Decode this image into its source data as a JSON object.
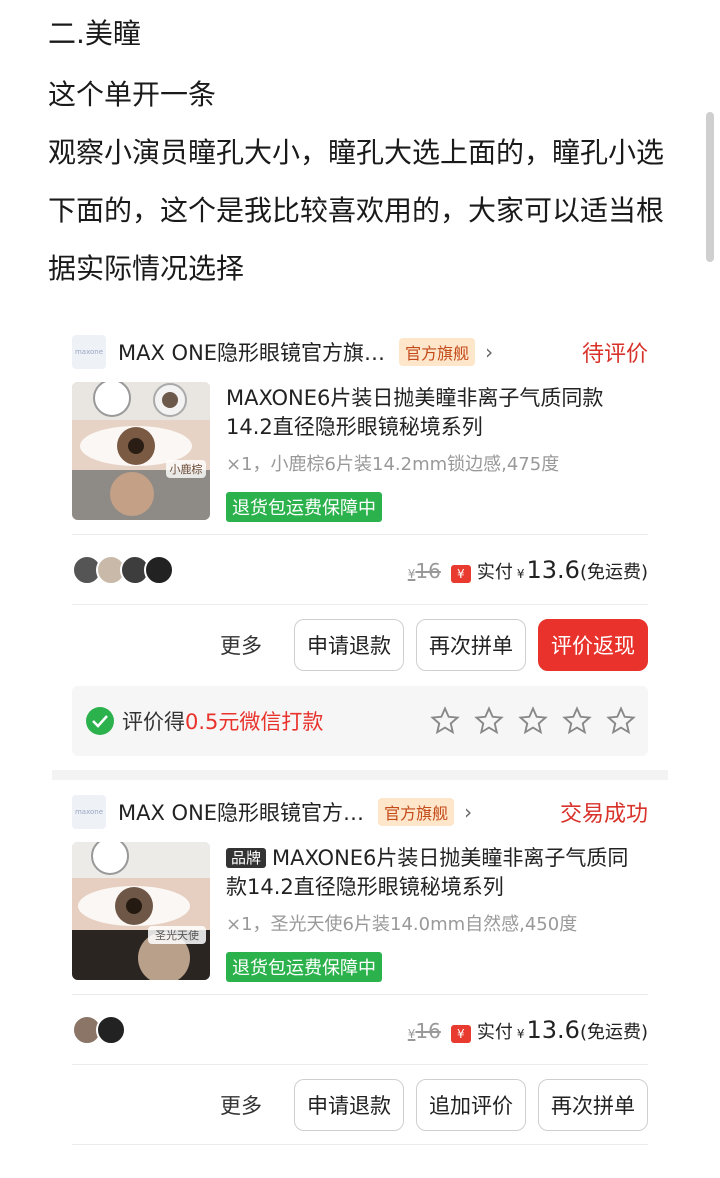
{
  "article": {
    "heading": "二.美瞳",
    "para1": "这个单开一条",
    "para2": "观察小演员瞳孔大小，瞳孔大选上面的，瞳孔小选下面的，这个是我比较喜欢用的，大家可以适当根据实际情况选择"
  },
  "orders": [
    {
      "shop_logo": "maxone",
      "shop_name": "MAX ONE隐形眼镜官方旗…",
      "shop_badge": "官方旗舰",
      "status": "待评价",
      "product_title": "MAXONE6片装日抛美瞳非离子气质同款14.2直径隐形眼镜秘境系列",
      "product_spec": "×1，小鹿棕6片装14.2mm锁边感,475度",
      "thumb_label": "小鹿棕",
      "guarantee": "退货包运费保障中",
      "orig_price": "16",
      "paid_label": "实付",
      "paid_amount": "13.6",
      "shipping": "(免运费)",
      "more": "更多",
      "buttons": [
        "申请退款",
        "再次拼单",
        "评价返现"
      ],
      "review_prefix": "评价得",
      "review_reward": "0.5元微信打款"
    },
    {
      "shop_logo": "maxone",
      "shop_name": "MAX ONE隐形眼镜官方…",
      "shop_badge": "官方旗舰",
      "status": "交易成功",
      "brand_tag": "品牌",
      "product_title": "MAXONE6片装日抛美瞳非离子气质同款14.2直径隐形眼镜秘境系列",
      "product_spec": "×1，圣光天使6片装14.0mm自然感,450度",
      "thumb_label": "圣光天使",
      "guarantee": "退货包运费保障中",
      "orig_price": "16",
      "paid_label": "实付",
      "paid_amount": "13.6",
      "shipping": "(免运费)",
      "more": "更多",
      "buttons": [
        "申请退款",
        "追加评价",
        "再次拼单"
      ]
    }
  ],
  "currency": "¥",
  "colors": {
    "accent_red": "#e8322b",
    "guarantee_green": "#2bb24c"
  },
  "review_stars": 0
}
